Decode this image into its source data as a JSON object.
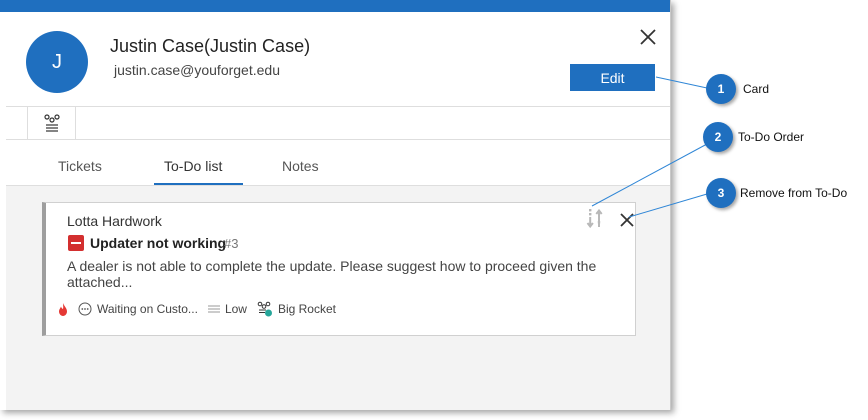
{
  "header": {
    "avatar_initial": "J",
    "name": "Justin Case(Justin Case)",
    "email": "justin.case@youforget.edu",
    "edit_label": "Edit"
  },
  "tabs": [
    {
      "label": "Tickets",
      "active": false
    },
    {
      "label": "To-Do list",
      "active": true
    },
    {
      "label": "Notes",
      "active": false
    }
  ],
  "card": {
    "contact": "Lotta Hardwork",
    "title": "Updater not working",
    "number": "#3",
    "description": "A dealer is not able to complete the update.  Please suggest how to proceed given the attached...",
    "status": "Waiting on Custo...",
    "priority": "Low",
    "team": "Big Rocket"
  },
  "callouts": [
    {
      "number": "1",
      "label": "Card"
    },
    {
      "number": "2",
      "label": "To-Do Order"
    },
    {
      "number": "3",
      "label": "Remove from To-Do"
    }
  ],
  "colors": {
    "accent": "#1f6fbf",
    "priority_urgent": "#d32f2f",
    "team_dot": "#26a69a"
  }
}
